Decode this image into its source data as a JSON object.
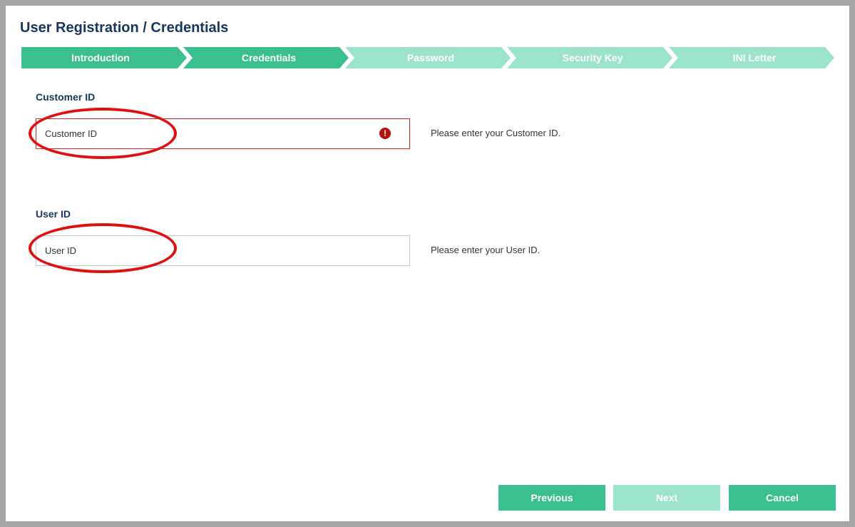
{
  "page": {
    "title": "User Registration / Credentials"
  },
  "steps": [
    {
      "label": "Introduction",
      "state": "done"
    },
    {
      "label": "Credentials",
      "state": "done"
    },
    {
      "label": "Password",
      "state": "todo"
    },
    {
      "label": "Security Key",
      "state": "todo"
    },
    {
      "label": "INI Letter",
      "state": "todo"
    }
  ],
  "customer_id": {
    "label": "Customer ID",
    "placeholder": "Customer ID",
    "value": "",
    "hint": "Please enter your Customer ID.",
    "error_icon": "exclamation-icon",
    "error_glyph": "!"
  },
  "user_id": {
    "label": "User ID",
    "placeholder": "User ID",
    "value": "",
    "hint": "Please enter your User ID."
  },
  "buttons": {
    "previous": "Previous",
    "next": "Next",
    "cancel": "Cancel"
  },
  "colors": {
    "step_done": "#3cbf8f",
    "step_todo": "#9ce3cb",
    "title": "#17365d",
    "error": "#d9232d",
    "annotation": "#e01010"
  }
}
